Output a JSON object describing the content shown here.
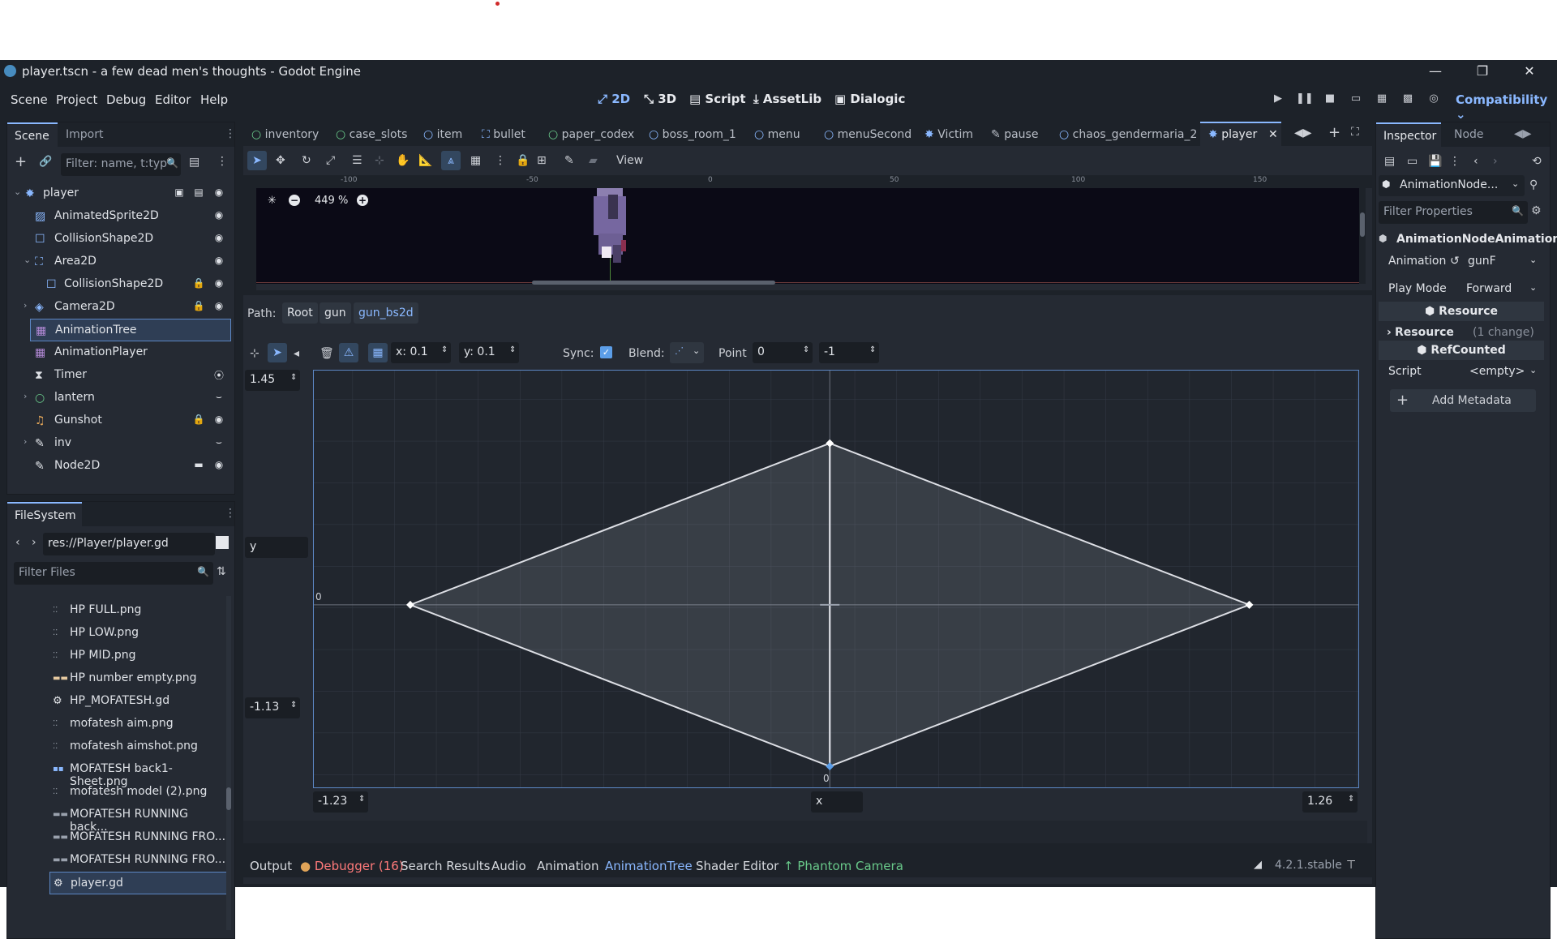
{
  "window": {
    "title": "player.tscn - a few dead men's thoughts - Godot Engine",
    "minimize": "—",
    "maximize": "❐",
    "close": "✕"
  },
  "menubar": {
    "items": [
      "Scene",
      "Project",
      "Debug",
      "Editor",
      "Help"
    ],
    "workspaces": [
      "2D",
      "3D",
      "Script",
      "AssetLib",
      "Dialogic"
    ],
    "renderer": "Compatibility"
  },
  "scene_dock": {
    "tabs": [
      "Scene",
      "Import"
    ],
    "filter_placeholder": "Filter: name, t:typ",
    "nodes": [
      {
        "name": "player",
        "icon": "node2d-icon"
      },
      {
        "name": "AnimatedSprite2D",
        "icon": "animated-sprite-icon"
      },
      {
        "name": "CollisionShape2D",
        "icon": "collision-shape-icon"
      },
      {
        "name": "Area2D",
        "icon": "area2d-icon"
      },
      {
        "name": "CollisionShape2D",
        "icon": "collision-shape-icon"
      },
      {
        "name": "Camera2D",
        "icon": "camera2d-icon"
      },
      {
        "name": "AnimationTree",
        "icon": "animation-tree-icon"
      },
      {
        "name": "AnimationPlayer",
        "icon": "animation-player-icon"
      },
      {
        "name": "Timer",
        "icon": "timer-icon"
      },
      {
        "name": "lantern",
        "icon": "light-icon"
      },
      {
        "name": "Gunshot",
        "icon": "audio-icon"
      },
      {
        "name": "inv",
        "icon": "script-node-icon"
      },
      {
        "name": "Node2D",
        "icon": "script-node-icon"
      }
    ]
  },
  "filesystem": {
    "tab": "FileSystem",
    "path": "res://Player/player.gd",
    "filter_placeholder": "Filter Files",
    "files": [
      "HP FULL.png",
      "HP LOW.png",
      "HP MID.png",
      "HP number empty.png",
      "HP_MOFATESH.gd",
      "mofatesh aim.png",
      "mofatesh aimshot.png",
      "MOFATESH back1-Sheet.png",
      "mofatesh model (2).png",
      "MOFATESH RUNNING back...",
      "MOFATESH RUNNING FRO...",
      "MOFATESH RUNNING FRO...",
      "player.gd"
    ]
  },
  "scene_tabs": [
    "inventory",
    "case_slots",
    "item",
    "bullet",
    "paper_codex",
    "boss_room_1",
    "menu",
    "menuSecond",
    "Victim",
    "pause",
    "chaos_gendermaria_2",
    "player"
  ],
  "viewport": {
    "view_menu": "View",
    "zoom": "449 %",
    "ruler_labels": [
      "-100",
      "-50",
      "0",
      "50",
      "100",
      "150"
    ]
  },
  "blend_editor": {
    "path_label": "Path:",
    "path": [
      "Root",
      "gun",
      "gun_bs2d"
    ],
    "snap_x": "x: 0.1",
    "snap_y": "y: 0.1",
    "sync_label": "Sync:",
    "blend_label": "Blend:",
    "point_label": "Point",
    "point_x": "0",
    "point_y": "-1",
    "max_y": "1.45",
    "min_y": "-1.13",
    "y_label": "y",
    "min_x": "-1.23",
    "max_x": "1.26",
    "x_label": "x",
    "zero_y": "0",
    "zero_x": "0",
    "points": [
      [
        0,
        1
      ],
      [
        -1,
        0
      ],
      [
        1,
        0
      ],
      [
        0,
        -1
      ]
    ]
  },
  "bottom_panel": {
    "tabs": [
      "Output",
      "Debugger (16)",
      "Search Results",
      "Audio",
      "Animation",
      "AnimationTree",
      "Shader Editor",
      "Phantom Camera"
    ],
    "version": "4.2.1.stable"
  },
  "inspector": {
    "tabs": [
      "Inspector",
      "Node"
    ],
    "object": "AnimationNode...",
    "filter_placeholder": "Filter Properties",
    "class_header": "AnimationNodeAnimation",
    "animation_label": "Animation",
    "animation_value": "gunF",
    "play_mode_label": "Play Mode",
    "play_mode_value": "Forward",
    "resource_header": "Resource",
    "resource_label": "Resource",
    "resource_changes": "(1 change)",
    "refcounted_header": "RefCounted",
    "script_label": "Script",
    "script_value": "<empty>",
    "add_metadata": "Add Metadata"
  },
  "colors": {
    "accent": "#8ab8ff",
    "debugger": "#ff7a7a",
    "phantom": "#69c98a",
    "bg": "#1d2229",
    "panel": "#252a33"
  }
}
